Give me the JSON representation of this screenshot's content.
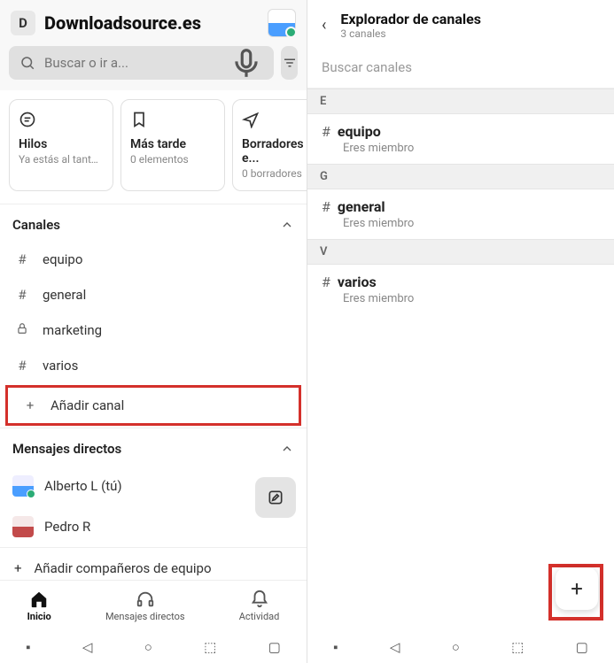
{
  "workspace": {
    "badge": "D",
    "name": "Downloadsource.es"
  },
  "search": {
    "placeholder": "Buscar o ir a..."
  },
  "cards": {
    "threads": {
      "title": "Hilos",
      "sub": "Ya estás al tanto ..."
    },
    "later": {
      "title": "Más tarde",
      "sub": "0 elementos"
    },
    "drafts": {
      "title": "Borradores y e...",
      "sub": "0 borradores"
    }
  },
  "sections": {
    "channels": "Canales",
    "dms": "Mensajes directos"
  },
  "channels": {
    "equipo": "equipo",
    "general": "general",
    "marketing": "marketing",
    "varios": "varios",
    "add": "Añadir canal"
  },
  "dms": {
    "alberto": "Alberto L (tú)",
    "pedro": "Pedro R"
  },
  "addTeammates": "Añadir compañeros de equipo",
  "bottomNav": {
    "home": "Inicio",
    "dms": "Mensajes directos",
    "activity": "Actividad"
  },
  "explorer": {
    "title": "Explorador de canales",
    "sub": "3 canales",
    "searchPlaceholder": "Buscar canales",
    "member": "Eres miembro",
    "letters": {
      "e": "E",
      "g": "G",
      "v": "V"
    },
    "ch": {
      "equipo": "equipo",
      "general": "general",
      "varios": "varios"
    }
  }
}
